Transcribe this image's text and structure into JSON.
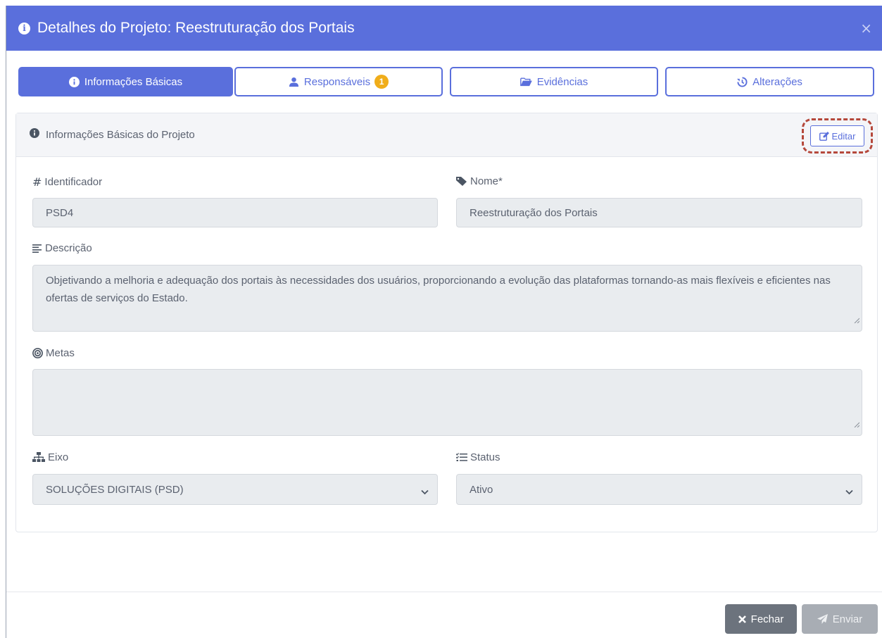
{
  "modal": {
    "title": "Detalhes do Projeto: Reestruturação dos Portais",
    "close_symbol": "×"
  },
  "tabs": [
    {
      "label": "Informações Básicas",
      "icon": "info-circle-icon",
      "active": true
    },
    {
      "label": "Responsáveis",
      "icon": "user-icon",
      "badge": "1",
      "active": false
    },
    {
      "label": "Evidências",
      "icon": "folder-open-icon",
      "active": false
    },
    {
      "label": "Alterações",
      "icon": "history-icon",
      "active": false
    }
  ],
  "card": {
    "title": "Informações Básicas do Projeto",
    "edit_label": "Editar"
  },
  "fields": {
    "identificador": {
      "label": "Identificador",
      "value": "PSD4",
      "icon": "hash-icon"
    },
    "nome": {
      "label": "Nome*",
      "value": "Reestruturação dos Portais",
      "icon": "tag-icon"
    },
    "descricao": {
      "label": "Descrição",
      "value": "Objetivando a melhoria e adequação dos portais às necessidades dos usuários, proporcionando a evolução das plataformas tornando-as mais flexíveis e eficientes nas ofertas de serviços do Estado.",
      "icon": "align-left-icon"
    },
    "metas": {
      "label": "Metas",
      "value": "",
      "icon": "target-icon"
    },
    "eixo": {
      "label": "Eixo",
      "value": "SOLUÇÕES DIGITAIS (PSD)",
      "icon": "sitemap-icon"
    },
    "status": {
      "label": "Status",
      "value": "Ativo",
      "icon": "list-check-icon"
    }
  },
  "footer": {
    "close_label": "Fechar",
    "send_label": "Enviar"
  },
  "colors": {
    "primary": "#5a6fdc",
    "badge": "#f0ad1a",
    "highlight": "#b5483b",
    "button_gray": "#6c737d"
  }
}
